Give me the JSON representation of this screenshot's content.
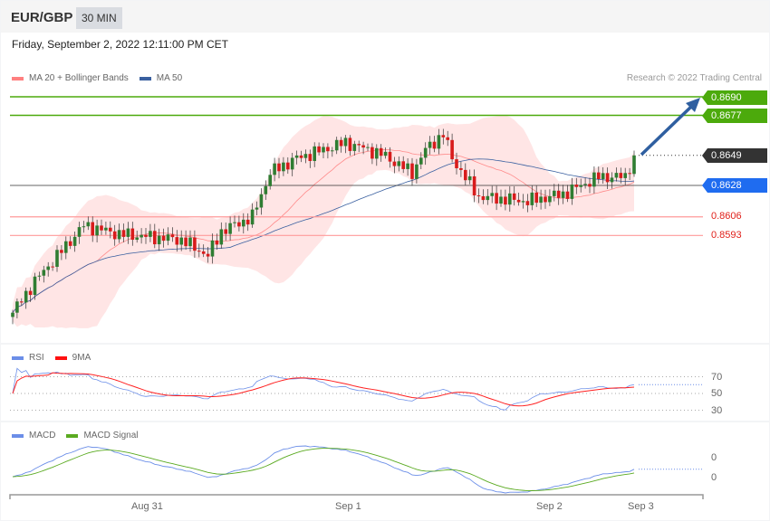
{
  "header": {
    "pair": "EUR/GBP",
    "timeframe": "30 MIN"
  },
  "date": "Friday, September 2, 2022 12:11:00 PM CET",
  "legend": {
    "bollinger": "MA 20 + Bollinger Bands",
    "ma50": "MA 50",
    "rsi": "RSI",
    "rsi_ma": "9MA",
    "macd": "MACD",
    "macd_signal": "MACD Signal"
  },
  "credit": "Research © 2022 Trading Central",
  "levels": {
    "r2": "0.8690",
    "r1": "0.8677",
    "last": "0.8649",
    "pivot": "0.8628",
    "s1": "0.8606",
    "s2": "0.8593"
  },
  "rsi_axis": [
    "70",
    "50",
    "30"
  ],
  "macd_axis": [
    "0",
    "0"
  ],
  "time_axis": [
    "Aug 31",
    "Sep 1",
    "Sep 2",
    "Sep 3"
  ],
  "colors": {
    "up": "#2f7d32",
    "down": "#d81b1b",
    "resistance": "#4caa0c",
    "pivot": "#1f6cf0",
    "last": "#333333",
    "support": "#e0201a",
    "ma50": "#3a60a0",
    "band": "#ffe0e0",
    "ma20": "#ff8a8a",
    "rsi": "#6b8ee8",
    "rsi_ma": "#ff2020",
    "macd": "#6b8ee8",
    "signal": "#5aaa20",
    "arrow": "#2f5fa0"
  },
  "chart_data": {
    "type": "candlestick",
    "bars": 141,
    "close_keypoints": [
      [
        0,
        0.8539
      ],
      [
        5,
        0.8561
      ],
      [
        16,
        0.86
      ],
      [
        24,
        0.8594
      ],
      [
        38,
        0.859
      ],
      [
        44,
        0.8579
      ],
      [
        47,
        0.8596
      ],
      [
        54,
        0.8606
      ],
      [
        58,
        0.8637
      ],
      [
        64,
        0.8647
      ],
      [
        75,
        0.8658
      ],
      [
        83,
        0.865
      ],
      [
        90,
        0.8637
      ],
      [
        93,
        0.8653
      ],
      [
        97,
        0.8664
      ],
      [
        99,
        0.8647
      ],
      [
        105,
        0.862
      ],
      [
        116,
        0.8617
      ],
      [
        124,
        0.8622
      ],
      [
        132,
        0.8634
      ],
      [
        138,
        0.8634
      ],
      [
        140,
        0.8649
      ]
    ],
    "forecast_target": 0.869
  }
}
